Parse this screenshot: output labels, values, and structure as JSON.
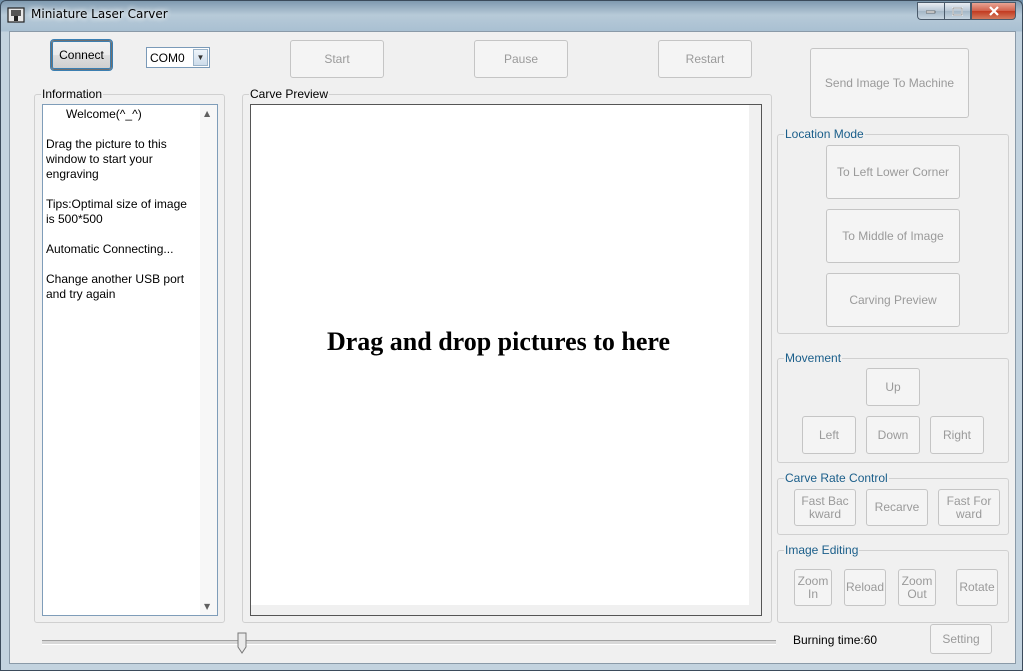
{
  "window": {
    "title": "Miniature Laser Carver"
  },
  "toolbar": {
    "connect": "Connect",
    "port": "COM0",
    "start": "Start",
    "pause": "Pause",
    "restart": "Restart",
    "send_image": "Send Image To Machine"
  },
  "info": {
    "label": "Information",
    "text": "      Welcome(^_^)\n\nDrag the picture to this window to start your engraving\n\nTips:Optimal size of image is 500*500\n\nAutomatic Connecting...\n\nChange another USB port and try again"
  },
  "preview": {
    "label": "Carve Preview",
    "drop_text": "Drag and drop pictures to here"
  },
  "location_mode": {
    "label": "Location Mode",
    "left_lower": "To Left Lower Corner",
    "middle": "To Middle of Image",
    "carving_preview": "Carving Preview"
  },
  "movement": {
    "label": "Movement",
    "up": "Up",
    "left": "Left",
    "down": "Down",
    "right": "Right"
  },
  "carve_rate": {
    "label": "Carve Rate Control",
    "fast_backward": "Fast  Bac kward",
    "recarve": "Recarve",
    "fast_forward": "Fast  For ward"
  },
  "image_editing": {
    "label": "Image Editing",
    "zoom_in": "Zoom In",
    "reload": "Reload",
    "zoom_out": "Zoom Out",
    "rotate": "Rotate"
  },
  "burn": {
    "label": "Burning time:60",
    "level": 0.27
  },
  "setting": "Setting",
  "colors": {
    "group_label": "#1a5e8a",
    "focus": "#3c7fb1"
  }
}
